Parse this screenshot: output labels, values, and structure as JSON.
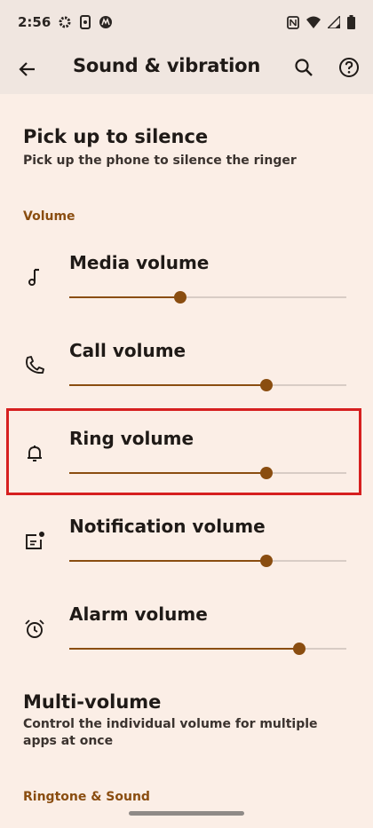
{
  "status_bar": {
    "time": "2:56",
    "icons": [
      "settings-icon",
      "phone-sync-icon",
      "motorola-icon",
      "nfc-icon",
      "wifi-icon",
      "signal-icon",
      "battery-icon"
    ]
  },
  "toolbar": {
    "title": "Sound & vibration",
    "back_icon": "back-arrow-icon",
    "search_icon": "search-icon",
    "help_icon": "help-icon"
  },
  "pick_up": {
    "title": "Pick up to silence",
    "subtitle": "Pick up the phone to silence the ringer"
  },
  "volume_section": {
    "title": "Volume",
    "items": [
      {
        "label": "Media volume",
        "icon": "music-note-icon",
        "level": 0.4
      },
      {
        "label": "Call volume",
        "icon": "phone-icon",
        "level": 0.71
      },
      {
        "label": "Ring volume",
        "icon": "bell-icon",
        "level": 0.71
      },
      {
        "label": "Notification volume",
        "icon": "notification-icon",
        "level": 0.71
      },
      {
        "label": "Alarm volume",
        "icon": "alarm-icon",
        "level": 0.83
      }
    ]
  },
  "multi_volume": {
    "title": "Multi-volume",
    "subtitle": "Control the individual volume for multiple apps at once"
  },
  "ringtone_section": {
    "title": "Ringtone & Sound"
  },
  "colors": {
    "accent": "#8a4d10",
    "background": "#fbeee6",
    "highlight": "#d61f1f"
  }
}
